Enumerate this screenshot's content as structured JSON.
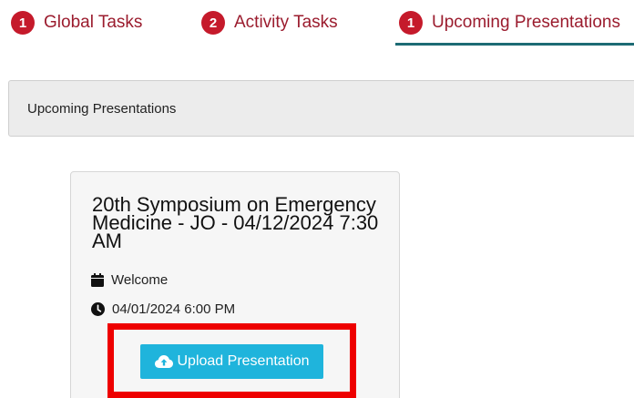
{
  "tabs": [
    {
      "count": "1",
      "label": "Global Tasks"
    },
    {
      "count": "2",
      "label": "Activity Tasks"
    },
    {
      "count": "1",
      "label": "Upcoming Presentations"
    }
  ],
  "section": {
    "title": "Upcoming Presentations"
  },
  "card": {
    "title": "20th Symposium on Emergency Medicine - JO - 04/12/2024 7:30 AM",
    "event_label": "Welcome",
    "datetime": "04/01/2024 6:00 PM",
    "upload_label": "Upload Presentation"
  },
  "icons": {
    "event": "calendar-icon",
    "time": "clock-icon",
    "upload": "cloud-upload-icon"
  },
  "colors": {
    "tab_text": "#9b1c2e",
    "badge": "#c51a2b",
    "active_underline": "#1d6b74",
    "button": "#1fb4dc",
    "highlight": "#ee0000"
  }
}
